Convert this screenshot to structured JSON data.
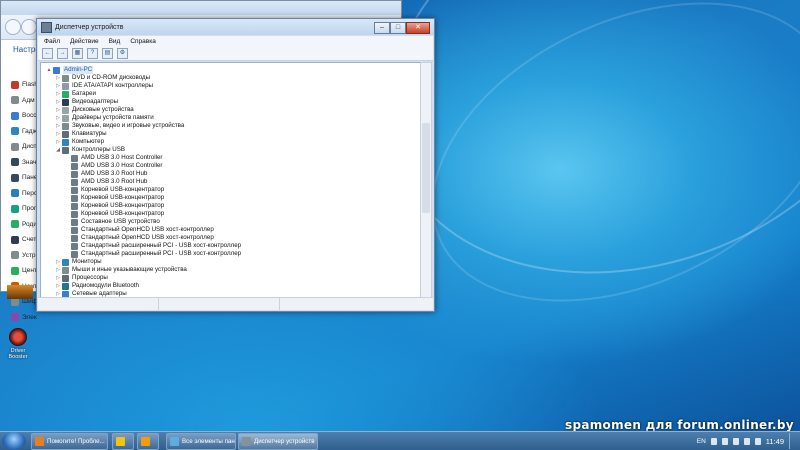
{
  "bg_window": {
    "title": "Настро",
    "items": [
      {
        "label": "Flash",
        "color": "#c0392b"
      },
      {
        "label": "Адм",
        "color": "#7f8c8d"
      },
      {
        "label": "Восс",
        "color": "#3a7bd5"
      },
      {
        "label": "Гадж",
        "color": "#2e86c1"
      },
      {
        "label": "Дисп",
        "color": "#7f8c8d"
      },
      {
        "label": "Знач",
        "color": "#34495e"
      },
      {
        "label": "Пане",
        "color": "#34495e"
      },
      {
        "label": "Перс",
        "color": "#2980b9"
      },
      {
        "label": "Прог",
        "color": "#16a085"
      },
      {
        "label": "Роди",
        "color": "#27ae60"
      },
      {
        "label": "Счет",
        "color": "#2c3e50"
      },
      {
        "label": "Устр",
        "color": "#7f8c8d"
      },
      {
        "label": "Цент",
        "color": "#27ae60"
      },
      {
        "label": "Цент",
        "color": "#d35400"
      },
      {
        "label": "Шиф",
        "color": "#7f8c8d"
      },
      {
        "label": "Элек",
        "color": "#8e44ad"
      }
    ]
  },
  "device_manager": {
    "title": "Диспетчер устройств",
    "controls": {
      "minimize": "–",
      "maximize": "□",
      "close": "✕"
    },
    "menu": [
      "Файл",
      "Действие",
      "Вид",
      "Справка"
    ],
    "toolbar": [
      "←",
      "→",
      "▦",
      "?",
      "▤",
      "⚙"
    ],
    "tree": [
      {
        "text": "Admin-PC",
        "level": 0,
        "expander": "▲",
        "icon": "#3a7bd5",
        "root": true
      },
      {
        "text": "DVD и CD-ROM дисководы",
        "level": 1,
        "expander": "▷",
        "icon": "#7f8c8d"
      },
      {
        "text": "IDE ATA/ATAPI контроллеры",
        "level": 1,
        "expander": "▷",
        "icon": "#8e9aa8"
      },
      {
        "text": "Батареи",
        "level": 1,
        "expander": "▷",
        "icon": "#27ae60"
      },
      {
        "text": "Видеоадаптеры",
        "level": 1,
        "expander": "▷",
        "icon": "#2c3e50"
      },
      {
        "text": "Дисковые устройства",
        "level": 1,
        "expander": "▷",
        "icon": "#95a5a6"
      },
      {
        "text": "Драйверы устройств памяти",
        "level": 1,
        "expander": "▷",
        "icon": "#95a5a6"
      },
      {
        "text": "Звуковые, видео и игровые устройства",
        "level": 1,
        "expander": "▷",
        "icon": "#7f8c8d"
      },
      {
        "text": "Клавиатуры",
        "level": 1,
        "expander": "▷",
        "icon": "#5d6d7e"
      },
      {
        "text": "Компьютер",
        "level": 1,
        "expander": "▷",
        "icon": "#2e86c1"
      },
      {
        "text": "Контроллеры USB",
        "level": 1,
        "expander": "◢",
        "icon": "#5d6d7e"
      },
      {
        "text": "AMD USB 3.0 Host Controller",
        "level": 2,
        "expander": "",
        "icon": "#6c7a89"
      },
      {
        "text": "AMD USB 3.0 Host Controller",
        "level": 2,
        "expander": "",
        "icon": "#6c7a89"
      },
      {
        "text": "AMD USB 3.0 Root Hub",
        "level": 2,
        "expander": "",
        "icon": "#6c7a89"
      },
      {
        "text": "AMD USB 3.0 Root Hub",
        "level": 2,
        "expander": "",
        "icon": "#6c7a89"
      },
      {
        "text": "Корневой USB-концентратор",
        "level": 2,
        "expander": "",
        "icon": "#6c7a89"
      },
      {
        "text": "Корневой USB-концентратор",
        "level": 2,
        "expander": "",
        "icon": "#6c7a89"
      },
      {
        "text": "Корневой USB-концентратор",
        "level": 2,
        "expander": "",
        "icon": "#6c7a89"
      },
      {
        "text": "Корневой USB-концентратор",
        "level": 2,
        "expander": "",
        "icon": "#6c7a89"
      },
      {
        "text": "Составное USB устройство",
        "level": 2,
        "expander": "",
        "icon": "#6c7a89"
      },
      {
        "text": "Стандартный OpenHCD USB хост-контроллер",
        "level": 2,
        "expander": "",
        "icon": "#6c7a89"
      },
      {
        "text": "Стандартный OpenHCD USB хост-контроллер",
        "level": 2,
        "expander": "",
        "icon": "#6c7a89"
      },
      {
        "text": "Стандартный расширенный PCI - USB хост-контроллер",
        "level": 2,
        "expander": "",
        "icon": "#6c7a89"
      },
      {
        "text": "Стандартный расширенный PCI - USB хост-контроллер",
        "level": 2,
        "expander": "",
        "icon": "#6c7a89"
      },
      {
        "text": "Мониторы",
        "level": 1,
        "expander": "▷",
        "icon": "#2e86c1"
      },
      {
        "text": "Мыши и иные указывающие устройства",
        "level": 1,
        "expander": "▷",
        "icon": "#7f8c8d"
      },
      {
        "text": "Процессоры",
        "level": 1,
        "expander": "▷",
        "icon": "#5d6d7e"
      },
      {
        "text": "Радиомодули Bluetooth",
        "level": 1,
        "expander": "▷",
        "icon": "#2471a3"
      },
      {
        "text": "Сетевые адаптеры",
        "level": 1,
        "expander": "▷",
        "icon": "#3a7bd5"
      }
    ]
  },
  "desktop": {
    "icons": [
      {
        "label": "",
        "color": "#b35a00"
      },
      {
        "label": "Driver Booster",
        "color": "#c0392b"
      }
    ],
    "watermark": "spamomen для forum.onliner.by"
  },
  "taskbar": {
    "tasks": [
      {
        "label": "Помогите! Пробле...",
        "color": "#e67e22"
      },
      {
        "label": "",
        "color": "#f1c40f"
      },
      {
        "label": "",
        "color": "#f39c12"
      },
      {
        "label": "Все элементы пане...",
        "color": "#5dade2"
      },
      {
        "label": "Диспетчер устройств",
        "color": "#85929e",
        "active": true
      }
    ],
    "lang": "EN",
    "clock": "11:49"
  }
}
